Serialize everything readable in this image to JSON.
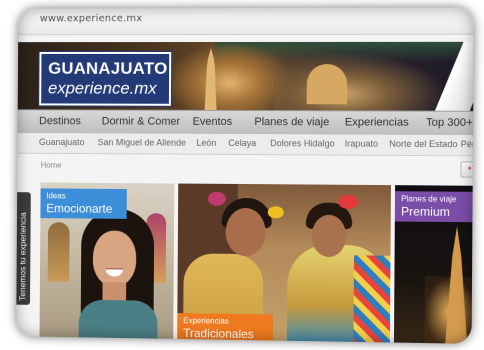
{
  "browser": {
    "url": "www.experience.mx"
  },
  "logo": {
    "line1": "GUANAJUATO",
    "line2": "experience.mx"
  },
  "main_nav": [
    "Destinos",
    "Dormir & Comer",
    "Eventos",
    "Planes de viaje",
    "Experiencias",
    "Top 300+"
  ],
  "sub_nav": [
    "Guanajuato",
    "San Miguel de Allende",
    "León",
    "Celaya",
    "Dolores Hidalgo",
    "Irapuato",
    "Norte del Estado",
    "Pén"
  ],
  "breadcrumb": "Home",
  "gplus": "+1",
  "side_tab": "Tenemos tu experiencia",
  "panels": [
    {
      "small": "Ideas",
      "big": "Emocionarte"
    },
    {
      "small": "Experiencias",
      "big": "Tradicionales"
    },
    {
      "small": "Planes de viaje",
      "big": "Premium"
    }
  ],
  "colors": {
    "logo_bg": "#233a77",
    "ideas": "#3d8ed8",
    "experiencias": "#f07a1f",
    "planes": "#7a4da8"
  }
}
